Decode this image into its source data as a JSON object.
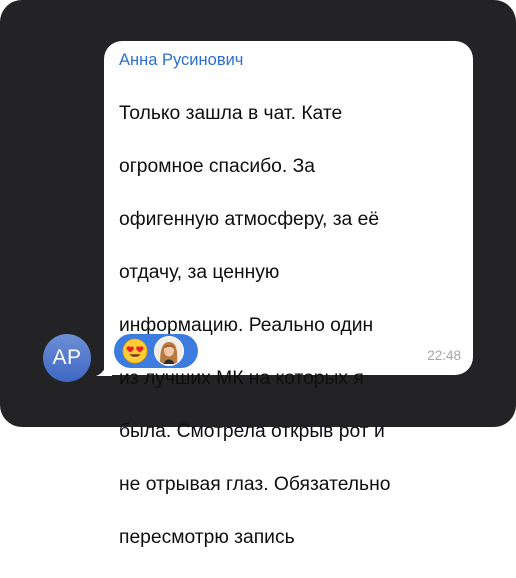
{
  "sender": {
    "name": "Анна Русинович",
    "initials": "АР",
    "avatar_colors": [
      "#6d8fd6",
      "#3f67c4"
    ],
    "name_color": "#2a6fd0"
  },
  "message": {
    "lines": [
      "Только зашла в чат. Кате",
      "огромное спасибо. За",
      "офигенную атмосферу, за её",
      "отдачу, за ценную",
      "информацию. Реально один",
      "из лучших МК на которых я",
      "была. Смотрела открыв рот и",
      "не отрывая глаз. Обязательно",
      "пересмотрю запись"
    ],
    "time": "22:48"
  },
  "reactions": [
    {
      "emoji_icon": "heart-eyes-emoji-icon",
      "reactor": "reactor-avatar"
    }
  ],
  "colors": {
    "background": "#232325",
    "bubble": "#ffffff",
    "reaction_pill": "#3c7be0",
    "timestamp": "#a4a6ab"
  }
}
